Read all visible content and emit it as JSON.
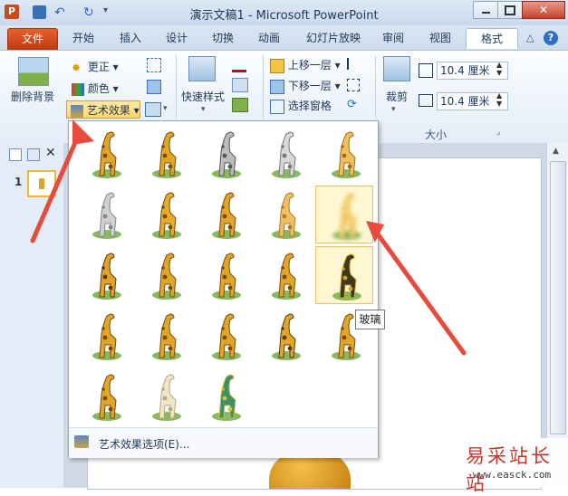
{
  "window": {
    "title": "演示文稿1 - Microsoft PowerPoint"
  },
  "tabs": [
    {
      "label": "文件"
    },
    {
      "label": "开始"
    },
    {
      "label": "插入"
    },
    {
      "label": "设计"
    },
    {
      "label": "切换"
    },
    {
      "label": "动画"
    },
    {
      "label": "幻灯片放映"
    },
    {
      "label": "审阅"
    },
    {
      "label": "视图"
    },
    {
      "label": "格式"
    }
  ],
  "ribbon": {
    "remove_background": "删除背景",
    "corrections": "更正",
    "color": "颜色",
    "artistic_effects": "艺术效果",
    "quick_styles": "快速样式",
    "bring_forward": "上移一层",
    "send_backward": "下移一层",
    "selection_pane": "选择窗格",
    "crop": "裁剪",
    "height": "10.4 厘米",
    "width": "10.4 厘米",
    "size_group": "大小"
  },
  "leftpane": {
    "slide_number": "1"
  },
  "gallery": {
    "options_label": "艺术效果选项(E)..."
  },
  "tooltip": "玻璃",
  "watermark": {
    "line1": "易采站长站",
    "line2": "www.easck.com"
  },
  "colors": {
    "accent": "#e64b3b",
    "file_tab": "#c23b11",
    "giraffe": "#e0a62a"
  }
}
